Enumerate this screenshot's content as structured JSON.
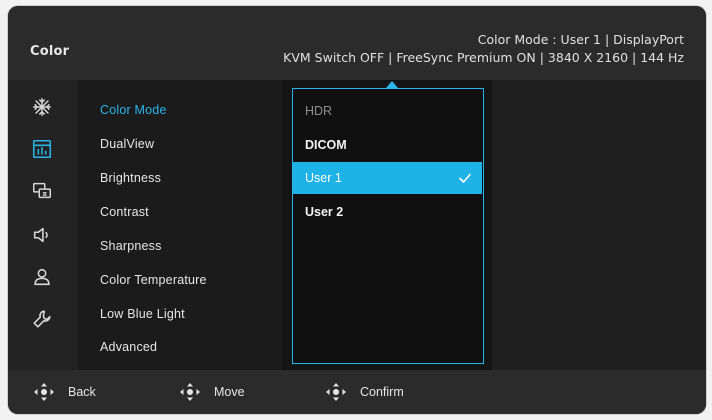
{
  "header": {
    "title": "Color",
    "status_line_1": "Color Mode  : User 1 |   DisplayPort",
    "status_line_2": "KVM Switch OFF | FreeSync Premium ON |  3840 X 2160  |  144 Hz"
  },
  "sidebar_icons": [
    {
      "name": "snowflake-icon"
    },
    {
      "name": "color-panel-icon"
    },
    {
      "name": "input-source-icon"
    },
    {
      "name": "speaker-icon"
    },
    {
      "name": "user-icon"
    },
    {
      "name": "wrench-icon"
    }
  ],
  "menu": {
    "items": [
      {
        "label": "Color Mode"
      },
      {
        "label": "DualView"
      },
      {
        "label": "Brightness"
      },
      {
        "label": "Contrast"
      },
      {
        "label": "Sharpness"
      },
      {
        "label": "Color Temperature"
      },
      {
        "label": "Low Blue Light"
      },
      {
        "label": "Advanced"
      }
    ],
    "active_index": 0
  },
  "dropdown": {
    "options": [
      {
        "label": "HDR",
        "state": "disabled"
      },
      {
        "label": "DICOM",
        "state": "normal"
      },
      {
        "label": "User 1",
        "state": "selected"
      },
      {
        "label": "User 2",
        "state": "normal"
      }
    ]
  },
  "footer": {
    "back_label": "Back",
    "move_label": "Move",
    "confirm_label": "Confirm"
  },
  "colors": {
    "accent": "#29b6ea",
    "selected_bg": "#1fb2e6",
    "header_bg": "#2b2b2b"
  }
}
